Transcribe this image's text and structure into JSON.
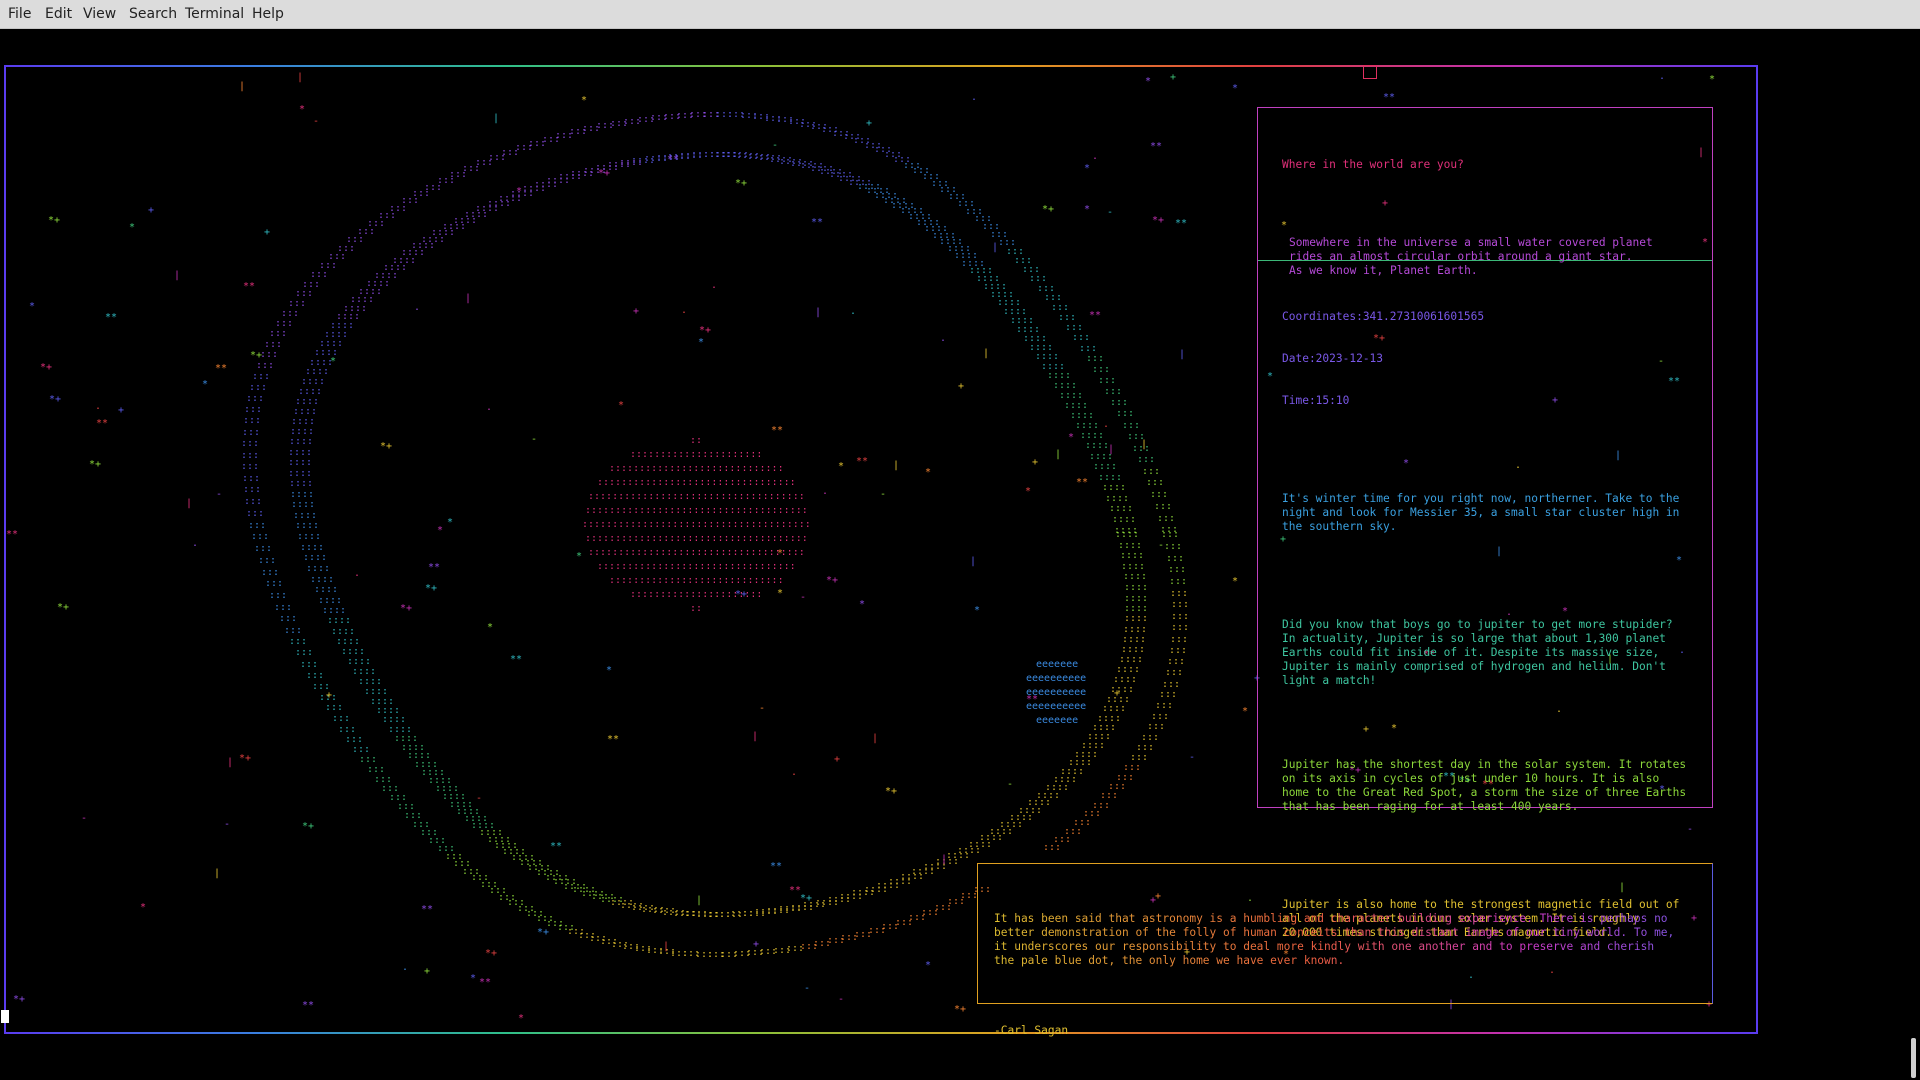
{
  "menubar": {
    "items": [
      "File",
      "Edit",
      "View",
      "Search",
      "Terminal",
      "Help"
    ]
  },
  "panel_top": {
    "heading": "Where in the world are you?",
    "intro": "Somewhere in the universe a small water covered planet\nrides an almost circular orbit around a giant star.\nAs we know it, Planet Earth."
  },
  "panel_info": {
    "coordinates": "Coordinates:341.27310061601565",
    "date": "Date:2023-12-13",
    "time": "Time:15:10",
    "winter": "It's winter time for you right now, northerner. Take to the\nnight and look for Messier 35, a small star cluster high in\nthe southern sky.",
    "fact1": "Did you know that boys go to jupiter to get more stupider?\nIn actuality, Jupiter is so large that about 1,300 planet\nEarths could fit inside of it. Despite its massive size,\nJupiter is mainly comprised of hydrogen and helium. Don't\nlight a match!",
    "fact2": "Jupiter has the shortest day in the solar system. It rotates\non its axis in cycles of just under 10 hours. It is also\nhome to the Great Red Spot, a storm the size of three Earths\nthat has been raging for at least 400 years.",
    "fact3": "Jupiter is also home to the strongest magnetic field out of\nall of the planets in our solar system. It is roughly\n20,000 times stronger than Earths magnetic field."
  },
  "quote": {
    "text": "It has been said that astronomy is a humbling and character building experience. There is perhaps no\nbetter demonstration of the folly of human conceits than this distant image of our tiny world. To me,\nit underscores our responsibility to deal more kindly with one another and to preserve and cherish\nthe pale blue dot, the only home we have ever known.",
    "author": "-Carl Sagan"
  },
  "colors": {
    "palette": [
      "#e0307a",
      "#c030b0",
      "#8a4ae0",
      "#5a5ae8",
      "#3a8ae0",
      "#2fb8c0",
      "#3ec67a",
      "#8cd83a",
      "#e0c030",
      "#f08030",
      "#e04040"
    ]
  }
}
